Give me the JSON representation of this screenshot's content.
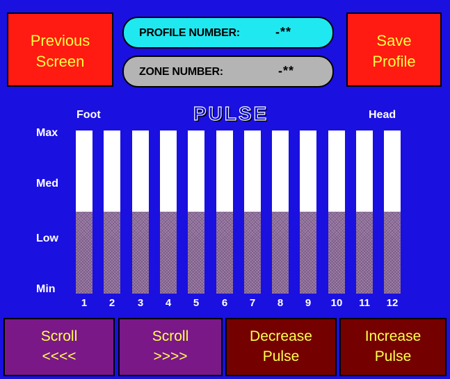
{
  "top": {
    "previous_label": [
      "Previous",
      "Screen"
    ],
    "save_label": [
      "Save",
      "Profile"
    ],
    "profile_label": "PROFILE NUMBER:",
    "profile_value": "-**",
    "zone_label": "ZONE NUMBER:",
    "zone_value": "-**"
  },
  "chart_data": {
    "type": "bar",
    "title": "PULSE",
    "left_label": "Foot",
    "right_label": "Head",
    "y_tick_labels": [
      "Max",
      "Med",
      "Low",
      "Min"
    ],
    "categories": [
      "1",
      "2",
      "3",
      "4",
      "5",
      "6",
      "7",
      "8",
      "9",
      "10",
      "11",
      "12"
    ],
    "values": [
      0.5,
      0.5,
      0.5,
      0.5,
      0.5,
      0.5,
      0.5,
      0.5,
      0.5,
      0.5,
      0.5,
      0.5
    ],
    "ylim": [
      0,
      1
    ]
  },
  "bottom": {
    "scroll_left": [
      "Scroll",
      "<<<<"
    ],
    "scroll_right": [
      "Scroll",
      ">>>>"
    ],
    "decrease": [
      "Decrease",
      "Pulse"
    ],
    "increase": [
      "Increase",
      "Pulse"
    ]
  },
  "colors": {
    "background": "#1a10e0",
    "red_button": "#ff1a12",
    "profile_pill": "#20e8f0",
    "zone_pill": "#b4b4b4",
    "purple_button": "#7a1888",
    "maroon_button": "#750000",
    "button_text": "#ffff40",
    "bar_fill": "#a081a8"
  }
}
